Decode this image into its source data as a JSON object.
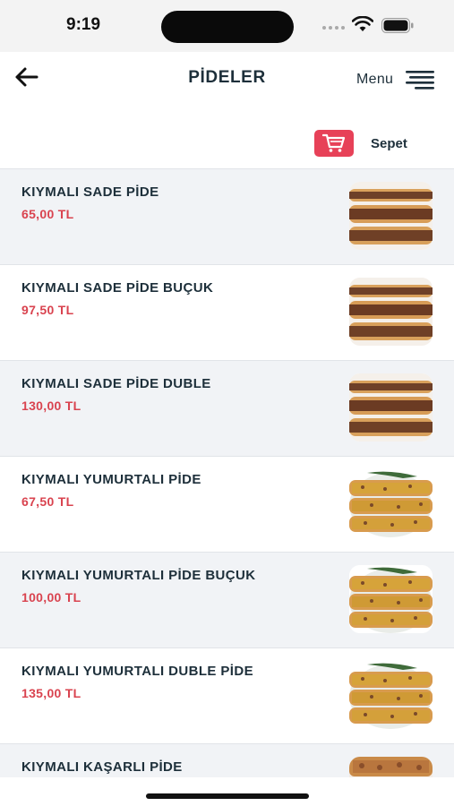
{
  "status_bar": {
    "time": "9:19"
  },
  "header": {
    "title": "PİDELER",
    "menu_label": "Menu"
  },
  "cart": {
    "label": "Sepet",
    "accent": "#e74158"
  },
  "colors": {
    "text": "#1d2f3a",
    "price": "#d9434f",
    "row_shade": "#f1f3f6"
  },
  "products": [
    {
      "name": "KIYMALI SADE PİDE",
      "price": "65,00 TL",
      "image": "minced-meat-pide"
    },
    {
      "name": "KIYMALI SADE PİDE BUÇUK",
      "price": "97,50 TL",
      "image": "minced-meat-pide"
    },
    {
      "name": "KIYMALI SADE PİDE DUBLE",
      "price": "130,00 TL",
      "image": "minced-meat-pide"
    },
    {
      "name": "KIYMALI YUMURTALI PİDE",
      "price": "67,50 TL",
      "image": "egg-pide"
    },
    {
      "name": "KIYMALI YUMURTALI PİDE BUÇUK",
      "price": "100,00 TL",
      "image": "egg-pide"
    },
    {
      "name": "KIYMALI YUMURTALI DUBLE PİDE",
      "price": "135,00 TL",
      "image": "egg-pide"
    },
    {
      "name": "KIYMALI KAŞARLI PİDE",
      "price": "",
      "image": "cheese-pide"
    }
  ]
}
